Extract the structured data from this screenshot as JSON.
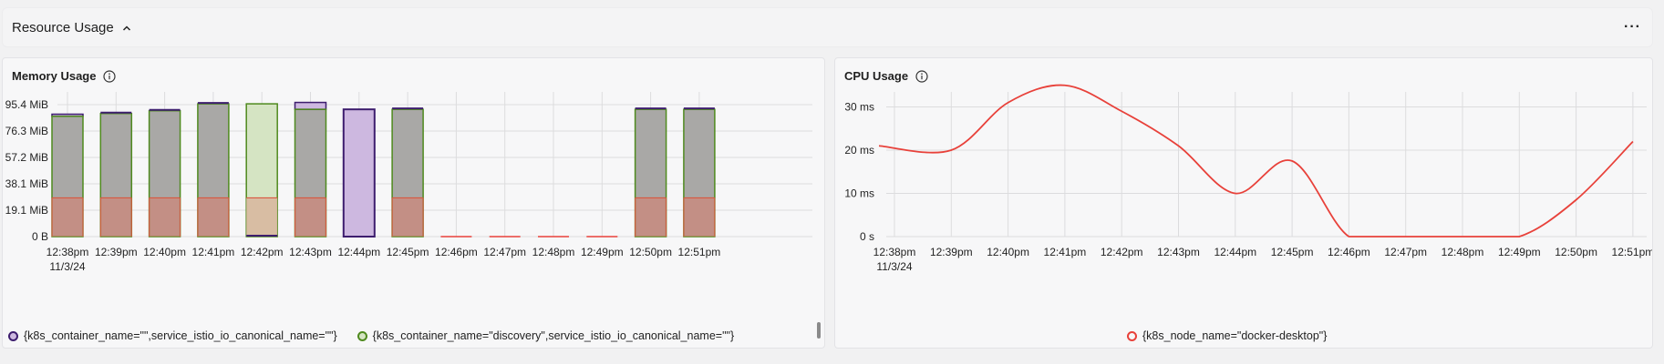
{
  "section": {
    "title": "Resource Usage",
    "more_label": "···"
  },
  "memory": {
    "title": "Memory Usage",
    "legend": [
      {
        "label": "{k8s_container_name=\"\",service_istio_io_canonical_name=\"\"}",
        "color": "#3d1d6e",
        "fill": "#cdb8e0"
      },
      {
        "label": "{k8s_container_name=\"discovery\",service_istio_io_canonical_name=\"\"}",
        "color": "#4f8a1e",
        "fill": "#d5e4c3"
      }
    ],
    "x_tick_date": "11/3/24"
  },
  "cpu": {
    "title": "CPU Usage",
    "legend": [
      {
        "label": "{k8s_node_name=\"docker-desktop\"}",
        "color": "#e8413a"
      }
    ],
    "x_tick_date": "11/3/24"
  },
  "colors": {
    "gray_bar": "#a9a8a6",
    "red_stack": "#d97a6a",
    "red_line": "#e8413a",
    "purple": "#3d1d6e",
    "green": "#4f8a1e"
  },
  "chart_data": [
    {
      "type": "bar",
      "title": "Memory Usage",
      "categories": [
        "12:38pm",
        "12:39pm",
        "12:40pm",
        "12:41pm",
        "12:42pm",
        "12:43pm",
        "12:44pm",
        "12:45pm",
        "12:46pm",
        "12:47pm",
        "12:48pm",
        "12:49pm",
        "12:50pm",
        "12:51pm"
      ],
      "y_ticks": [
        "0 B",
        "19.1 MiB",
        "38.1 MiB",
        "57.2 MiB",
        "76.3 MiB",
        "95.4 MiB"
      ],
      "ylim": [
        0,
        95.4
      ],
      "stack_base_mib": 28,
      "series": [
        {
          "name": "{k8s_container_name=\"\",service_istio_io_canonical_name=\"\"}",
          "values": [
            88.5,
            88,
            90,
            95,
            95,
            97,
            92,
            91,
            0,
            0,
            0,
            0,
            91,
            91
          ]
        },
        {
          "name": "{k8s_container_name=\"discovery\",service_istio_io_canonical_name=\"\"}",
          "values": [
            87,
            89,
            91,
            96,
            96,
            92,
            0,
            92,
            0,
            0,
            0,
            0,
            92,
            92
          ]
        }
      ],
      "grid": true
    },
    {
      "type": "line",
      "title": "CPU Usage",
      "x": [
        "12:38pm",
        "12:39pm",
        "12:40pm",
        "12:41pm",
        "12:42pm",
        "12:43pm",
        "12:44pm",
        "12:45pm",
        "12:46pm",
        "12:47pm",
        "12:48pm",
        "12:49pm",
        "12:50pm",
        "12:51pm"
      ],
      "y_ticks": [
        "0 s",
        "10 ms",
        "20 ms",
        "30 ms"
      ],
      "ylim": [
        0,
        38
      ],
      "series": [
        {
          "name": "{k8s_node_name=\"docker-desktop\"}",
          "values": [
            21,
            20,
            31,
            35,
            29,
            21,
            10,
            17.5,
            0,
            0,
            0,
            0,
            8.5,
            22
          ]
        }
      ],
      "grid": true
    }
  ]
}
